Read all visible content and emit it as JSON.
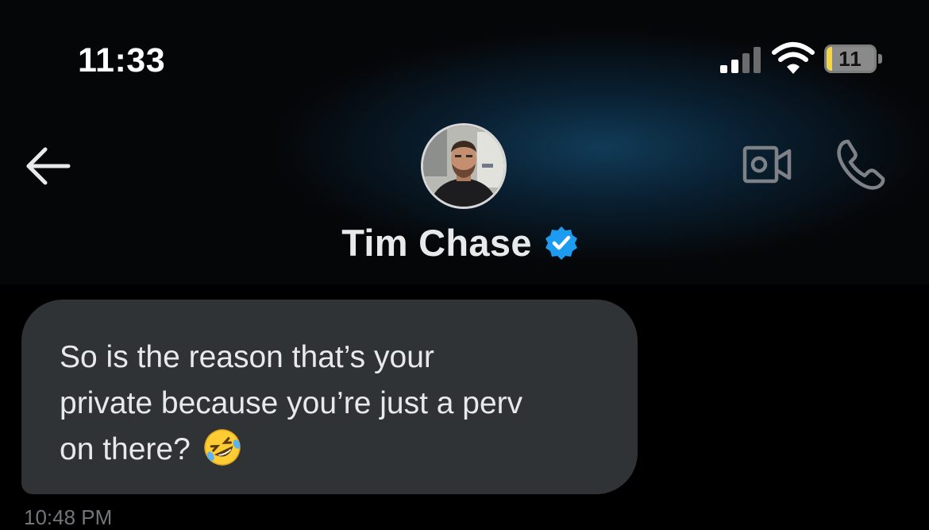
{
  "status_bar": {
    "time": "11:33",
    "battery_percent": "11",
    "battery_level": 0.11,
    "signal_bars_active": 2,
    "signal_bars_total": 4,
    "battery_fill_color": "#f2d64b"
  },
  "header": {
    "back_icon": "arrow-left-icon",
    "contact_name": "Tim Chase",
    "verified_icon": "verified-badge-icon",
    "verified_color": "#1d9bf0",
    "video_icon": "video-camera-icon",
    "call_icon": "phone-icon"
  },
  "conversation": {
    "messages": [
      {
        "sender": "Tim Chase",
        "text_lines": [
          "So is the reason that’s your",
          "private because you’re just a perv",
          "on there?"
        ],
        "emoji": "🤣",
        "timestamp": "10:48 PM",
        "bubble_color": "#2f3336"
      }
    ]
  }
}
